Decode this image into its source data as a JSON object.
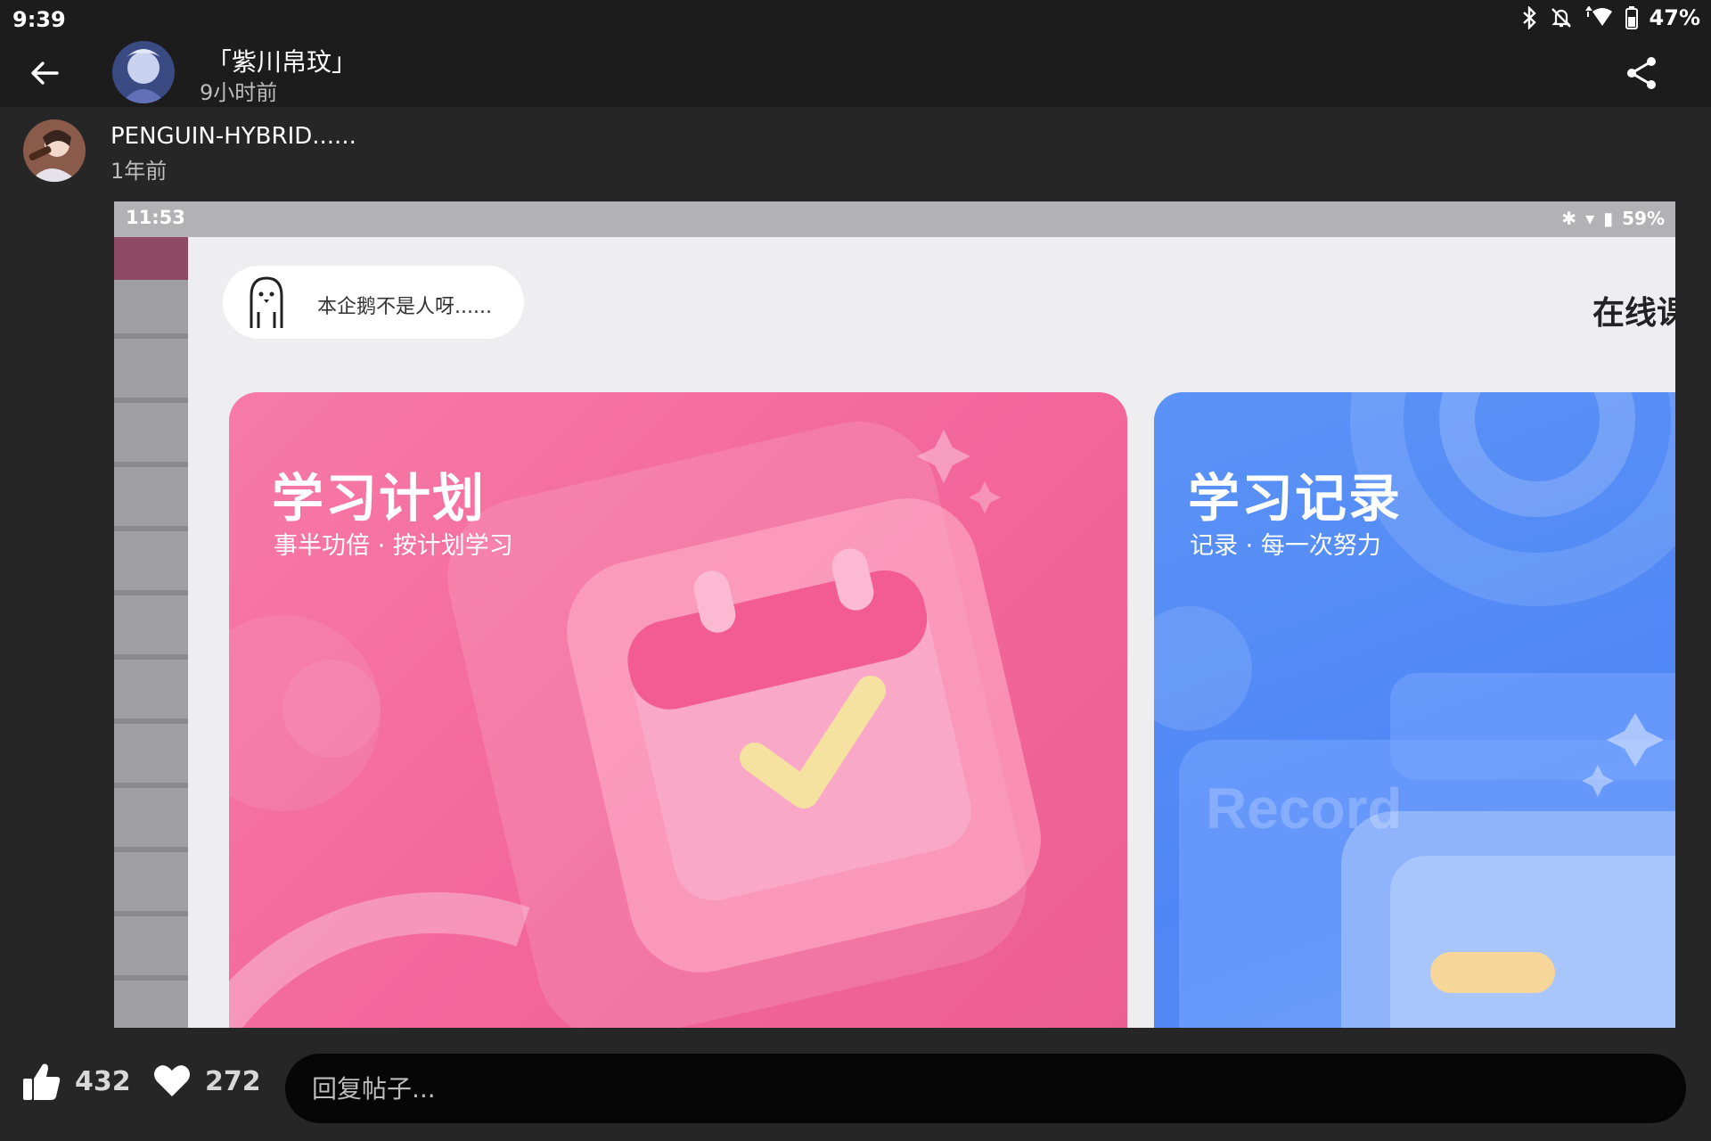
{
  "status_bar": {
    "time": "9:39",
    "battery": "47%",
    "icons": [
      "bluetooth-icon",
      "mute-icon",
      "wifi-icon",
      "battery-icon"
    ]
  },
  "app_bar": {
    "back_icon": "back-arrow-icon",
    "op_name": "「紫川帛玟」",
    "op_time": "9小时前",
    "share_icon": "share-icon"
  },
  "post": {
    "author": "PENGUIN-HYBRID......",
    "time": "1年前"
  },
  "screenshot": {
    "time": "11:53",
    "battery": "59%",
    "bubble_text": "本企鹅不是人呀......",
    "heading_partial": "在线课",
    "cards": [
      {
        "title": "学习计划",
        "subtitle": "事半功倍 · 按计划学习",
        "color": "#f2669a"
      },
      {
        "title": "学习记录",
        "subtitle": "记录 · 每一次努力",
        "watermark": "Record",
        "color": "#4f86f5"
      }
    ]
  },
  "bottom": {
    "likes": "432",
    "favorites": "272",
    "reply_placeholder": "回复帖子..."
  },
  "colors": {
    "bar": "#1c1c1c",
    "background": "#262626",
    "input": "#060606"
  }
}
